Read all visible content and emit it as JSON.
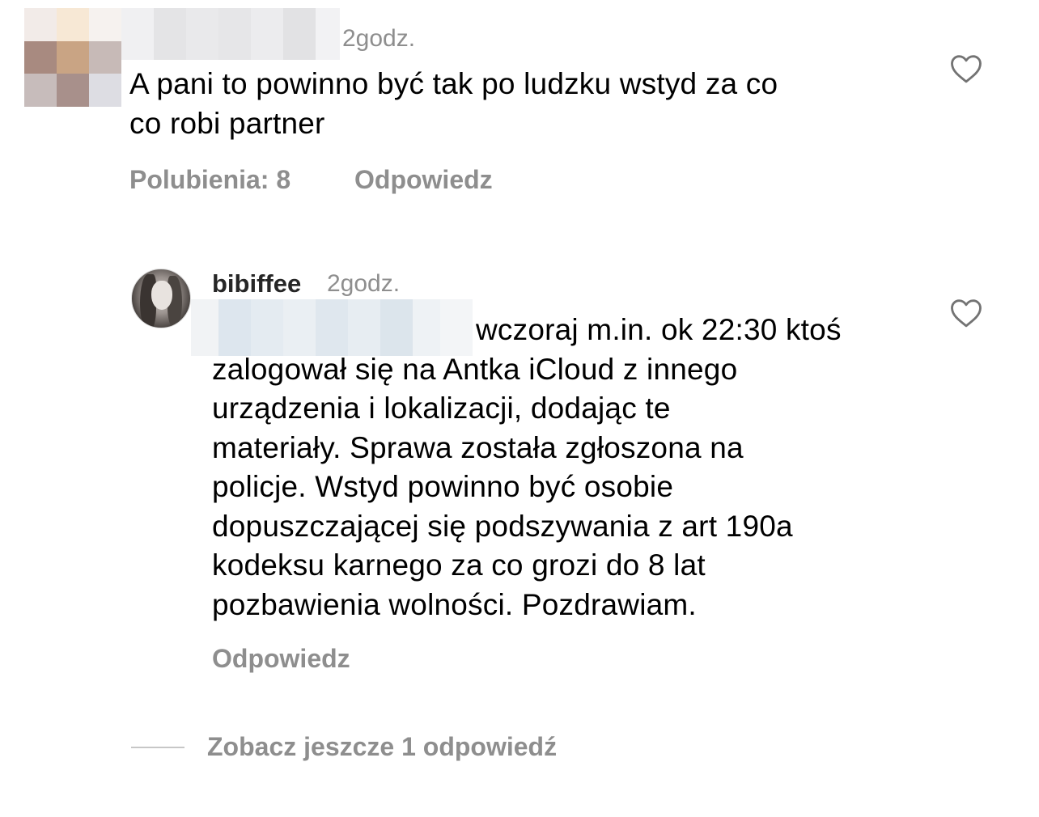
{
  "comment1": {
    "timestamp": "2godz.",
    "text_line1": "A pani to powinno być tak po ludzku wstyd za co",
    "text_line2": "co robi partner",
    "likes_label": "Polubienia: 8",
    "reply_label": "Odpowiedz",
    "avatar_colors": [
      "#f2ebe8",
      "#f7e8d5",
      "#f6f2ef",
      "#a88a80",
      "#c9a484",
      "#c7bab7",
      "#c7bcbb",
      "#a8908b",
      "#dddde3"
    ],
    "like_icon": "heart-outline-icon"
  },
  "comment2": {
    "username": "bibiffee",
    "timestamp": "2godz.",
    "lines": [
      "wczoraj m.in. ok 22:30 ktoś",
      "zalogował się na Antka iCloud z innego",
      "urządzenia i lokalizacji, dodając te",
      "materiały. Sprawa została zgłoszona na",
      "policje. Wstyd powinno być osobie",
      "dopuszczającej się podszywania z art 190a",
      "kodeksu karnego za co grozi do 8 lat",
      "pozbawienia wolności. Pozdrawiam."
    ],
    "reply_label": "Odpowiedz",
    "like_icon": "heart-outline-icon"
  },
  "more_replies": {
    "label": "Zobacz jeszcze 1 odpowiedź"
  },
  "colors": {
    "text": "#000000",
    "secondary": "#8e8e8e",
    "divider": "#c7c7c7",
    "background": "#ffffff"
  }
}
